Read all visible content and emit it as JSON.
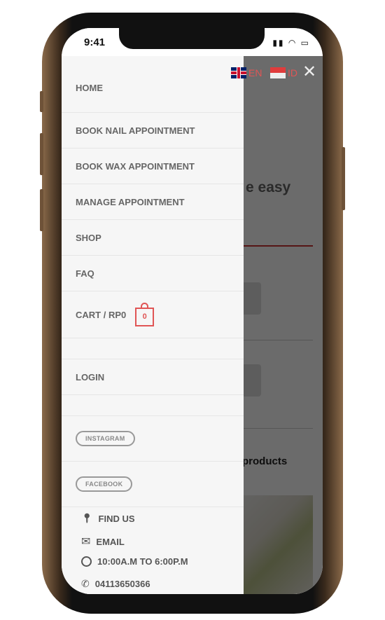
{
  "status_bar": {
    "time": "9:41"
  },
  "languages": [
    {
      "code": "EN",
      "icon": "uk-flag-icon"
    },
    {
      "code": "ID",
      "icon": "indonesia-flag-icon"
    }
  ],
  "menu": {
    "items": [
      "HOME",
      "BOOK NAIL APPOINTMENT",
      "BOOK WAX APPOINTMENT",
      "MANAGE APPOINTMENT",
      "SHOP",
      "FAQ"
    ],
    "cart": {
      "label": "CART / RP0",
      "count": "0"
    },
    "login": "LOGIN",
    "social": [
      "INSTAGRAM",
      "FACEBOOK"
    ],
    "contacts": [
      {
        "icon": "location-pin-icon",
        "label": "FIND US"
      },
      {
        "icon": "envelope-icon",
        "label": "EMAIL"
      },
      {
        "icon": "clock-icon",
        "label": "10:00A.M TO 6:00P.M"
      },
      {
        "icon": "phone-icon",
        "label": "04113650366"
      }
    ]
  },
  "background": {
    "heading_fragment": "e easy",
    "products_fragment": "products"
  },
  "colors": {
    "accent": "#e05555",
    "menu_bg": "#f6f6f6"
  }
}
